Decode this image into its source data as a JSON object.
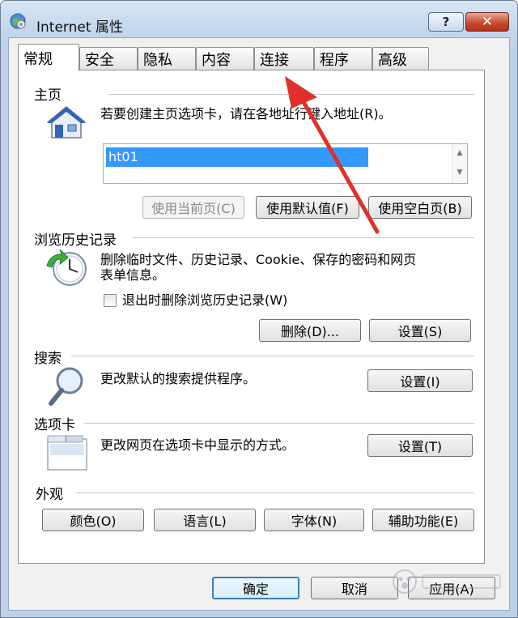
{
  "window": {
    "title": "Internet 属性",
    "help_label": "?",
    "close_label": "✕"
  },
  "tabs": [
    {
      "label": "常规"
    },
    {
      "label": "安全"
    },
    {
      "label": "隐私"
    },
    {
      "label": "内容"
    },
    {
      "label": "连接"
    },
    {
      "label": "程序"
    },
    {
      "label": "高级"
    }
  ],
  "homepage": {
    "heading": "主页",
    "description": "若要创建主页选项卡，请在各地址行键入地址(R)。",
    "url_value": "ht01",
    "buttons": {
      "use_current": "使用当前页(C)",
      "use_default": "使用默认值(F)",
      "use_blank": "使用空白页(B)"
    }
  },
  "history": {
    "heading": "浏览历史记录",
    "description_line1": "删除临时文件、历史记录、Cookie、保存的密码和网页",
    "description_line2": "表单信息。",
    "checkbox_label": "退出时删除浏览历史记录(W)",
    "delete_button": "删除(D)...",
    "settings_button": "设置(S)"
  },
  "search": {
    "heading": "搜索",
    "description": "更改默认的搜索提供程序。",
    "settings_button": "设置(I)"
  },
  "tabs_section": {
    "heading": "选项卡",
    "description": "更改网页在选项卡中显示的方式。",
    "settings_button": "设置(T)"
  },
  "appearance": {
    "heading": "外观",
    "buttons": {
      "colors": "颜色(O)",
      "languages": "语言(L)",
      "fonts": "字体(N)",
      "accessibility": "辅助功能(E)"
    }
  },
  "footer": {
    "ok": "确定",
    "cancel": "取消",
    "apply": "应用(A)"
  }
}
